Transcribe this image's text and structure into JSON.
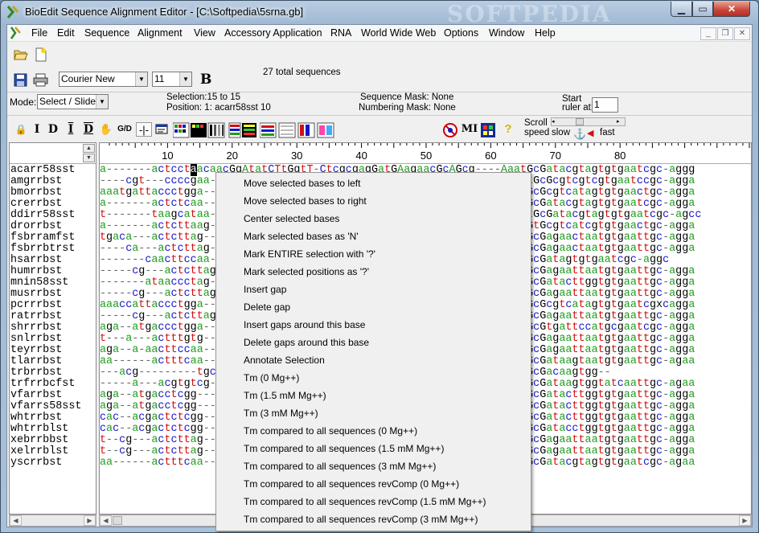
{
  "window": {
    "title": "BioEdit Sequence Alignment Editor - [C:\\Softpedia\\5srna.gb]",
    "watermark": "SOFTPEDIA",
    "min_glyph": "▁",
    "max_glyph": "▭",
    "close_glyph": "✕"
  },
  "menubar": {
    "items": [
      "File",
      "Edit",
      "Sequence",
      "Alignment",
      "View",
      "Accessory Application",
      "RNA",
      "World Wide Web",
      "Options",
      "Window",
      "Help"
    ],
    "mdi": [
      "_",
      "❐",
      "✕"
    ]
  },
  "toolbar": {
    "font": "Courier New",
    "font_size": "11",
    "bold_label": "B",
    "total_sequences": "27 total sequences",
    "mode_label": "Mode:",
    "mode_value": "Select / Slide",
    "selection": "Selection:15 to 15",
    "position": "Position:  1: acarr58sst 10",
    "sequence_mask": "Sequence Mask: None",
    "numbering_mask": "Numbering Mask: None",
    "start_ruler": "Start",
    "ruler_at": "ruler at:",
    "ruler_value": "1",
    "scroll_speed": "Scroll",
    "speed_label": "speed",
    "slow": "slow",
    "fast": "fast",
    "tool_labels": [
      "I",
      "D",
      "I",
      "D",
      "G/D",
      "MI"
    ]
  },
  "ruler": {
    "ticks": [
      "10",
      "20",
      "30",
      "40",
      "50",
      "60",
      "70",
      "80"
    ]
  },
  "sequences": [
    {
      "name": "acarr58sst",
      "seq": "a-------actcctaacaacGgAtatCTtGgtT-CtcgcgagGatGAagaacGcAGcg----AaatGcGatacgtagtgtgaatcgc-aggg"
    },
    {
      "name": "amgrrbst",
      "seq": "----cgt---ccccgaa----------------------------------------------AtctGcGcgtcgtcgtgaatccgc-agga"
    },
    {
      "name": "bmorrbst",
      "seq": "aaatgattaccctgga----------------------------------------------AaatGcGcgtcatagtgtgaactgc-agga"
    },
    {
      "name": "crerrbst",
      "seq": "a-------actctcaa----------------------------------------------AaatGcGatacgtagtgtgaatcgc-agga"
    },
    {
      "name": "ddirr58sst",
      "seq": "t-------taagcataa---------------------------------------------AacttGcGatacgtagtgtgaatcgc-agcc"
    },
    {
      "name": "drorrbst",
      "seq": "a-------actcttaag---------------------------------------------AactGtGcgtcatcgtgtgaactgc-agga"
    },
    {
      "name": "fsbrramfst",
      "seq": "tgaca---actcttag----------------------------------------------AgctGcGagaactaatgtgaattgc-agga"
    },
    {
      "name": "fsbrrbtrst",
      "seq": "----ca---actcttag---------------------------------------------AgctGcGagaactaatgtgaattgc-agga"
    },
    {
      "name": "hsarrbst",
      "seq": "-------caacttccaa---------------------------------------------AactGcGatagtgtgaatcgc-aggc"
    },
    {
      "name": "humrrbst",
      "seq": "-----cg---actcttag--------------------------------------------AgctGcGagaattaatgtgaattgc-agga"
    },
    {
      "name": "mnin58sst",
      "seq": "-------ataaccctag---------------------------------------------AaatGcGatacttggtgtgaattgc-agga"
    },
    {
      "name": "musrrbst",
      "seq": "-----cg---actcttag--------------------------------------------AgctGcGagaattaatgtgaattgc-agga"
    },
    {
      "name": "pcrrrbst",
      "seq": "aaaccattaccctgga----------------------------------------------AactGcGcgtcatagtgtgaatcgxcagga"
    },
    {
      "name": "ratrrbst",
      "seq": "-----cg---actcttag--------------------------------------------AgctGcGagaattaatgtgaattgc-agga"
    },
    {
      "name": "shrrrbst",
      "seq": "aga--atgaccctgga----------------------------------------------AgacGcGtgattccatgcgaatcgc-agga"
    },
    {
      "name": "snlrrbst",
      "seq": "t---a---actttgtg----------------------------------------------AgctGcGagaattaatgtgaattgc-agga"
    },
    {
      "name": "teyrrbst",
      "seq": "aga--a-aacttccaa----------------------------------------------AgctGcGagaattaatgtgaattgc-agga"
    },
    {
      "name": "tlarrbst",
      "seq": "aa------actttcaa----------------------------------------------AaatGcGataagtaatgtgaattgc-agaa"
    },
    {
      "name": "trbrrbst",
      "seq": "---acg---------tgcg-------------------------------------------AaagGcGacaagtgg--"
    },
    {
      "name": "trfrrbcfst",
      "seq": "-----a---acgtgtcg---------------------------------------------AagtGcGataagtggtatcaattgc-agaa"
    },
    {
      "name": "vfarrbst",
      "seq": "aga--atgacctcgg-----------------------------------------------AgctGcGatacttggtgtgaattgc-agga"
    },
    {
      "name": "vfarrs58sst",
      "seq": "aga--atgacctcgg-----------------------------------------------AgctGcGatacttggtgtgaattgc-agga"
    },
    {
      "name": "whtrrbst",
      "seq": "cac--acgactctcgg----------------------------------------------AgctGcGatacttggtgtgaattgc-agga"
    },
    {
      "name": "whtrrblst",
      "seq": "cac--acgactctcgg----------------------------------------------AgctGcGatacctggtgtgaattgc-agga"
    },
    {
      "name": "xebrrbbst",
      "seq": "t--cg---actcttag----------------------------------------------AgctGcGagaattaatgtgaattgc-agga"
    },
    {
      "name": "xelrrblst",
      "seq": "t--cg---actcttag----------------------------------------------AgctGcGagaattaatgtgaattgc-agga"
    },
    {
      "name": "yscrrbst",
      "seq": "aa------actttcaa----------------------------------------------AaatGcGatacgtagtgtgaatcgc-agaa"
    }
  ],
  "context_menu": {
    "items": [
      "Move selected bases to left",
      "Move selected bases to right",
      "Center selected bases",
      "Mark selected bases as 'N'",
      "Mark ENTIRE selection with '?'",
      "Mark selected positions as '?'",
      "Insert gap",
      "Delete gap",
      "Insert gaps around this base",
      "Delete gaps around this base",
      "Annotate Selection",
      "Tm (0 Mg++)",
      "Tm (1.5 mM Mg++)",
      "Tm (3 mM Mg++)",
      "Tm compared to all sequences (0 Mg++)",
      "Tm compared to all sequences (1.5 mM Mg++)",
      "Tm compared to all sequences (3 mM Mg++)",
      "Tm compared to all sequences revComp (0 Mg++)",
      "Tm compared to all sequences revComp (1.5 mM Mg++)",
      "Tm compared to all sequences revComp (3 mM Mg++)"
    ]
  },
  "colors": {
    "a": "#1f9c1f",
    "c": "#1515c8",
    "g": "#000000",
    "t": "#d01010",
    "gap": "#666666",
    "highlight_bg": "#000000"
  }
}
